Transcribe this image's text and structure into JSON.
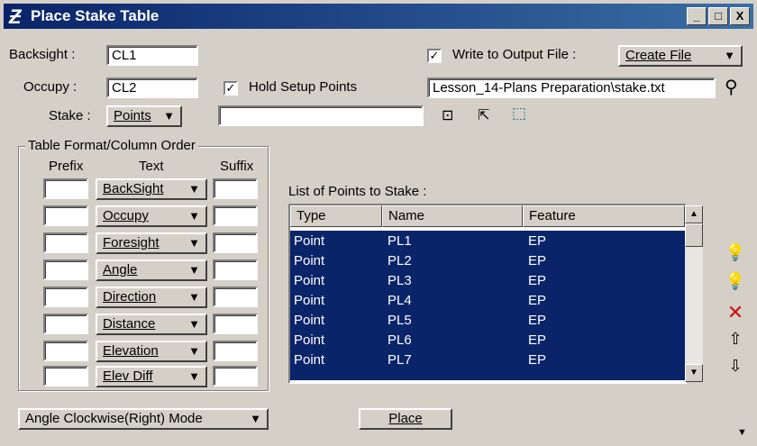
{
  "window": {
    "title": "Place Stake Table",
    "minimize": "_",
    "maximize": "□",
    "close": "X"
  },
  "backsight": {
    "label": "Backsight :",
    "value": "CL1"
  },
  "occupy": {
    "label": "Occupy :",
    "value": "CL2"
  },
  "stake": {
    "label": "Stake :",
    "option": "Points",
    "value": ""
  },
  "hold_setup": {
    "checked": true,
    "label": "Hold Setup Points"
  },
  "write_output": {
    "checked": true,
    "label": "Write to Output File :",
    "mode": "Create File",
    "file": "Lesson_14-Plans Preparation\\stake.txt"
  },
  "table_format": {
    "title": "Table Format/Column Order",
    "headers": {
      "prefix": "Prefix",
      "text": "Text",
      "suffix": "Suffix"
    },
    "rows": [
      {
        "prefix": "",
        "text": "BackSight",
        "suffix": ""
      },
      {
        "prefix": "",
        "text": "Occupy",
        "suffix": ""
      },
      {
        "prefix": "",
        "text": "Foresight",
        "suffix": ""
      },
      {
        "prefix": "",
        "text": "Angle",
        "suffix": ""
      },
      {
        "prefix": "",
        "text": "Direction",
        "suffix": ""
      },
      {
        "prefix": "",
        "text": "Distance",
        "suffix": ""
      },
      {
        "prefix": "",
        "text": "Elevation",
        "suffix": ""
      },
      {
        "prefix": "",
        "text": "Elev Diff",
        "suffix": ""
      }
    ]
  },
  "points_list": {
    "label": "List of Points to Stake :",
    "columns": [
      "Type",
      "Name",
      "Feature"
    ],
    "rows": [
      {
        "type": "Point",
        "name": "PL1",
        "feature": "EP"
      },
      {
        "type": "Point",
        "name": "PL2",
        "feature": "EP"
      },
      {
        "type": "Point",
        "name": "PL3",
        "feature": "EP"
      },
      {
        "type": "Point",
        "name": "PL4",
        "feature": "EP"
      },
      {
        "type": "Point",
        "name": "PL5",
        "feature": "EP"
      },
      {
        "type": "Point",
        "name": "PL6",
        "feature": "EP"
      },
      {
        "type": "Point",
        "name": "PL7",
        "feature": "EP"
      }
    ]
  },
  "angle_mode": "Angle Clockwise(Right) Mode",
  "place_button": "Place",
  "colors": {
    "selection": "#0a246a",
    "titlebar": "#0a246a",
    "face": "#d4d0c8"
  }
}
